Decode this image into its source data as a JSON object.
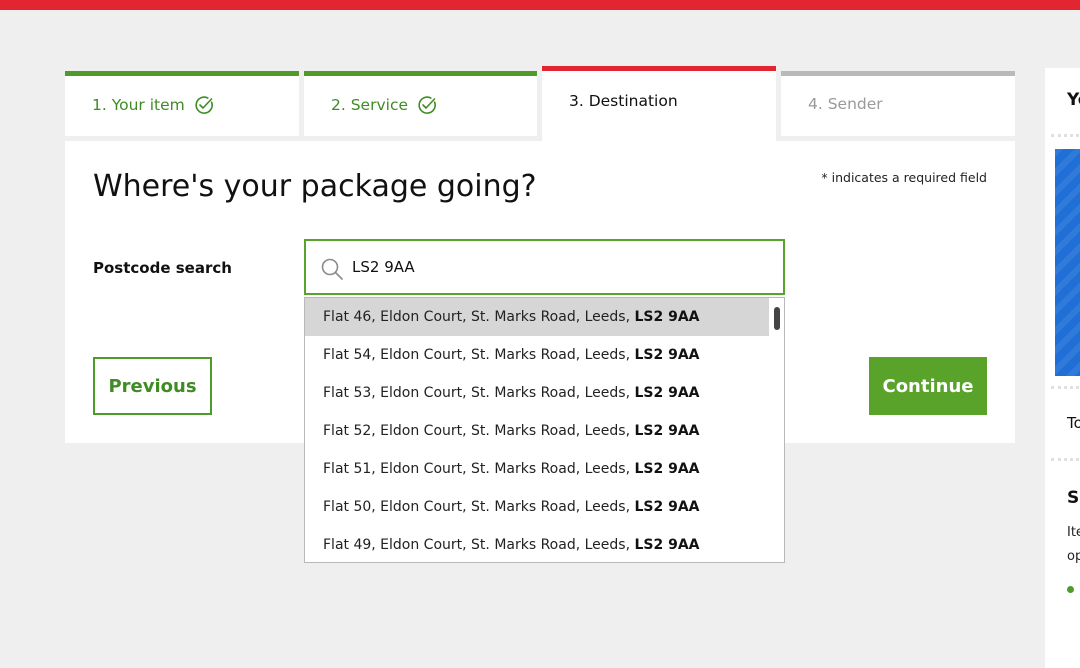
{
  "steps": [
    {
      "label": "1. Your item",
      "state": "done"
    },
    {
      "label": "2. Service",
      "state": "done"
    },
    {
      "label": "3. Destination",
      "state": "active"
    },
    {
      "label": "4. Sender",
      "state": "pending"
    }
  ],
  "form": {
    "title": "Where's your package going?",
    "required_note": "* indicates a required field",
    "postcode_label": "Postcode search",
    "postcode_value": "LS2 9AA",
    "previous_label": "Previous",
    "continue_label": "Continue"
  },
  "suggestions": [
    {
      "address": "Flat 46, Eldon Court, St. Marks Road, Leeds, ",
      "postcode": "LS2 9AA",
      "highlighted": true
    },
    {
      "address": "Flat 54, Eldon Court, St. Marks Road, Leeds, ",
      "postcode": "LS2 9AA"
    },
    {
      "address": "Flat 53, Eldon Court, St. Marks Road, Leeds, ",
      "postcode": "LS2 9AA"
    },
    {
      "address": "Flat 52, Eldon Court, St. Marks Road, Leeds, ",
      "postcode": "LS2 9AA"
    },
    {
      "address": "Flat 51, Eldon Court, St. Marks Road, Leeds, ",
      "postcode": "LS2 9AA"
    },
    {
      "address": "Flat 50, Eldon Court, St. Marks Road, Leeds, ",
      "postcode": "LS2 9AA"
    },
    {
      "address": "Flat 49, Eldon Court, St. Marks Road, Leeds, ",
      "postcode": "LS2 9AA"
    }
  ],
  "side_panel": {
    "heading": "Yo",
    "total_label": "To",
    "section_heading": "Se",
    "text_line1": "Ite",
    "text_line2": "op"
  },
  "colors": {
    "brand_red": "#e32431",
    "done_green": "#4e9b2a",
    "button_green": "#5aa32b",
    "pending_grey": "#b9b9b9"
  },
  "icons": {
    "step_done": "check-circle-icon",
    "search": "search-icon"
  }
}
